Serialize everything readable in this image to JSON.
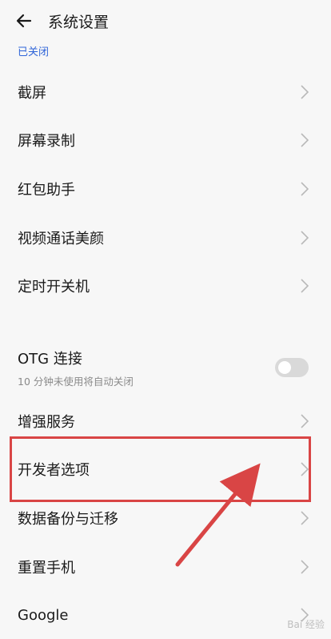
{
  "header": {
    "title": "系统设置"
  },
  "status_text": "已关闭",
  "items": [
    {
      "label": "截屏"
    },
    {
      "label": "屏幕录制"
    },
    {
      "label": "红包助手"
    },
    {
      "label": "视频通话美颜"
    },
    {
      "label": "定时开关机"
    }
  ],
  "otg": {
    "label": "OTG 连接",
    "sub": "10 分钟未使用将自动关闭",
    "enabled": false
  },
  "items2": [
    {
      "label": "增强服务"
    },
    {
      "label": "开发者选项"
    },
    {
      "label": "数据备份与迁移"
    },
    {
      "label": "重置手机"
    },
    {
      "label": "Google"
    }
  ],
  "watermark": "Bai 经验",
  "colors": {
    "accent": "#2f64d8",
    "annotation": "#d94545"
  }
}
